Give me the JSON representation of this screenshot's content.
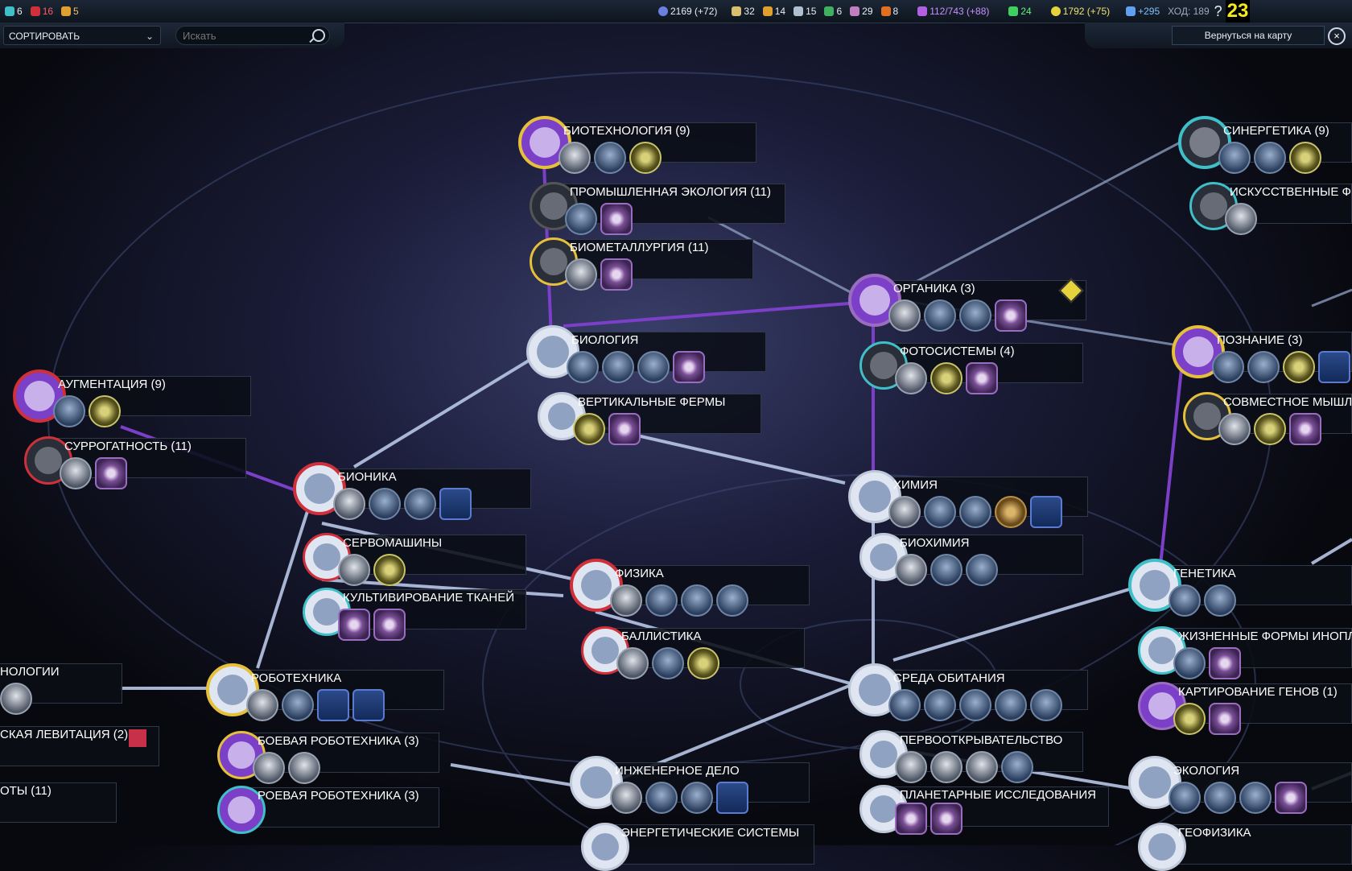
{
  "topbar": {
    "stat_affinity_1": "6",
    "stat_affinity_2": "16",
    "stat_affinity_3": "5",
    "science": "2169 (+72)",
    "res_1": "32",
    "res_2": "14",
    "res_3": "15",
    "res_4": "6",
    "res_5": "29",
    "res_6": "8",
    "culture": "112/743 (+88)",
    "health": "24",
    "energy": "1792 (+75)",
    "science_rate": "+295",
    "turn": "ХОД: 189",
    "help": "?",
    "counter": "23"
  },
  "toolbar": {
    "sort_label": "СОРТИРОВАТЬ",
    "search_placeholder": "Искать",
    "back_label": "Вернуться на карту"
  },
  "nodes": [
    {
      "id": "biotech",
      "name": "БИОТЕХНОЛОГИЯ (9)"
    },
    {
      "id": "indeco",
      "name": "ПРОМЫШЛЕННАЯ ЭКОЛОГИЯ (11)"
    },
    {
      "id": "biometal",
      "name": "БИОМЕТАЛЛУРГИЯ (11)"
    },
    {
      "id": "biology",
      "name": "БИОЛОГИЯ"
    },
    {
      "id": "vertfarm",
      "name": "ВЕРТИКАЛЬНЫЕ ФЕРМЫ"
    },
    {
      "id": "organics",
      "name": "ОРГАНИКА (3)"
    },
    {
      "id": "photo",
      "name": "ФОТОСИСТЕМЫ (4)"
    },
    {
      "id": "synergy",
      "name": "СИНЕРГЕТИКА (9)"
    },
    {
      "id": "artificial",
      "name": "ИСКУССТВЕННЫЕ Ф"
    },
    {
      "id": "cognition",
      "name": "ПОЗНАНИЕ (3)"
    },
    {
      "id": "joint",
      "name": "СОВМЕСТНОЕ МЫШЛ"
    },
    {
      "id": "augment",
      "name": "АУГМЕНТАЦИЯ (9)"
    },
    {
      "id": "surrogacy",
      "name": "СУРРОГАТНОСТЬ (11)"
    },
    {
      "id": "bionics",
      "name": "БИОНИКА"
    },
    {
      "id": "servo",
      "name": "СЕРВОМАШИНЫ"
    },
    {
      "id": "tissue",
      "name": "КУЛЬТИВИРОВАНИЕ ТКАНЕЙ"
    },
    {
      "id": "physics",
      "name": "ФИЗИКА"
    },
    {
      "id": "ballistics",
      "name": "БАЛЛИСТИКА"
    },
    {
      "id": "chemistry",
      "name": "ХИМИЯ"
    },
    {
      "id": "biochem",
      "name": "БИОХИМИЯ"
    },
    {
      "id": "genetics",
      "name": "ГЕНЕТИКА"
    },
    {
      "id": "lifeforms",
      "name": "ЖИЗНЕННЫЕ ФОРМЫ ИНОПЛ"
    },
    {
      "id": "genemap",
      "name": "КАРТИРОВАНИЕ ГЕНОВ (1)"
    },
    {
      "id": "robotics",
      "name": "РОБОТЕХНИКА"
    },
    {
      "id": "combatrob",
      "name": "БОЕВАЯ РОБОТЕХНИКА (3)"
    },
    {
      "id": "swarmrob",
      "name": "РОЕВАЯ РОБОТЕХНИКА (3)"
    },
    {
      "id": "habitat",
      "name": "СРЕДА ОБИТАНИЯ"
    },
    {
      "id": "pioneer",
      "name": "ПЕРВООТКРЫВАТЕЛЬСТВО"
    },
    {
      "id": "planetary",
      "name": "ПЛАНЕТАРНЫЕ ИССЛЕДОВАНИЯ"
    },
    {
      "id": "engineering",
      "name": "ИНЖЕНЕРНОЕ ДЕЛО"
    },
    {
      "id": "energy",
      "name": "ЭНЕРГЕТИЧЕСКИЕ СИСТЕМЫ"
    },
    {
      "id": "ecology",
      "name": "ЭКОЛОГИЯ"
    },
    {
      "id": "geophys",
      "name": "ГЕОФИЗИКА"
    },
    {
      "id": "nology",
      "name": "НОЛОГИИ"
    },
    {
      "id": "levit",
      "name": "СКАЯ ЛЕВИТАЦИЯ (2)"
    },
    {
      "id": "oty",
      "name": "ОТЫ (11)"
    }
  ]
}
